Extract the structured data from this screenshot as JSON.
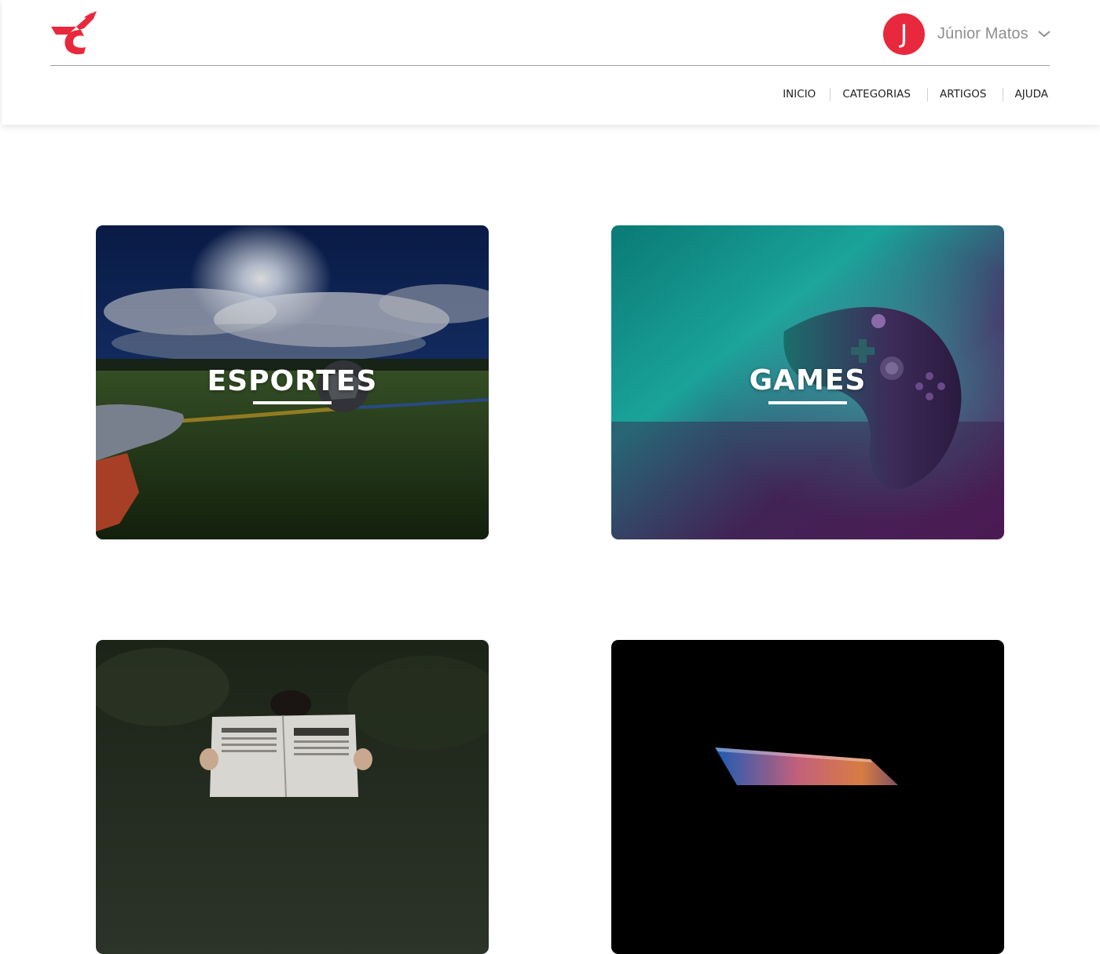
{
  "brand": {
    "accent_color": "#e8283c",
    "logo_icon": "winged-c-logo"
  },
  "user": {
    "initial": "J",
    "name": "Júnior Matos",
    "menu_icon": "chevron-down-icon"
  },
  "nav": {
    "items": [
      {
        "label": "INICIO"
      },
      {
        "label": "CATEGORIAS"
      },
      {
        "label": "ARTIGOS"
      },
      {
        "label": "AJUDA"
      }
    ]
  },
  "categories": [
    {
      "title": "ESPORTES"
    },
    {
      "title": "GAMES"
    },
    {
      "title": ""
    },
    {
      "title": ""
    }
  ]
}
